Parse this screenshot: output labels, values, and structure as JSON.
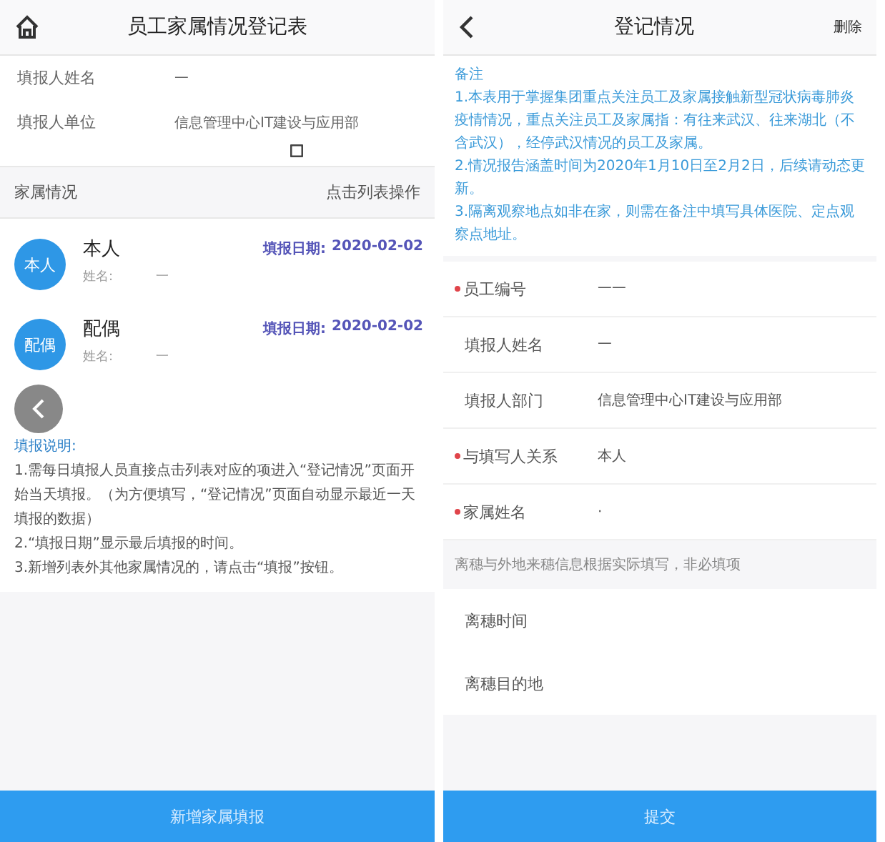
{
  "left": {
    "title": "员工家属情况登记表",
    "fields": [
      {
        "label": "填报人姓名",
        "value": "一"
      },
      {
        "label": "填报人单位",
        "value": "信息管理中心IT建设与应用部"
      }
    ],
    "section": {
      "title": "家属情况",
      "action": "点击列表操作"
    },
    "members": [
      {
        "avatar": "本人",
        "name": "本人",
        "sub_label": "姓名:",
        "sub_value": "一",
        "date_label": "填报日期:",
        "date": "2020-02-02"
      },
      {
        "avatar": "配偶",
        "name": "配偶",
        "sub_label": "姓名:",
        "sub_value": "一",
        "date_label": "填报日期:",
        "date": "2020-02-02"
      }
    ],
    "notes_title": "填报说明:",
    "notes": [
      "1.需每日填报人员直接点击列表对应的项进入“登记情况”页面开始当天填报。（为方便填写，“登记情况”页面自动显示最近一天填报的数据）",
      "2.“填报日期”显示最后填报的时间。",
      "3.新增列表外其他家属情况的，请点击“填报”按钮。"
    ],
    "button": "新增家属填报"
  },
  "right": {
    "title": "登记情况",
    "action": "删除",
    "notes_title": "备注",
    "notes": [
      "1.本表用于掌握集团重点关注员工及家属接触新型冠状病毒肺炎疫情情况，重点关注员工及家属指：有往来武汉、往来湖北（不含武汉），经停武汉情况的员工及家属。",
      "2.情况报告涵盖时间为2020年1月10日至2月2日，后续请动态更新。",
      "3.隔离观察地点如非在家，则需在备注中填写具体医院、定点观察点地址。"
    ],
    "fields": [
      {
        "label": "员工编号",
        "value": "一一",
        "required": true
      },
      {
        "label": "填报人姓名",
        "value": "一",
        "required": false
      },
      {
        "label": "填报人部门",
        "value": "信息管理中心IT建设与应用部",
        "required": false
      },
      {
        "label": "与填写人关系",
        "value": "本人",
        "required": true
      },
      {
        "label": "家属姓名",
        "value": "·",
        "required": true
      }
    ],
    "hint": "离穗与外地来穗信息根据实际填写，非必填项",
    "optional_fields": [
      {
        "label": "离穗时间"
      },
      {
        "label": "离穗目的地"
      }
    ],
    "button": "提交"
  }
}
